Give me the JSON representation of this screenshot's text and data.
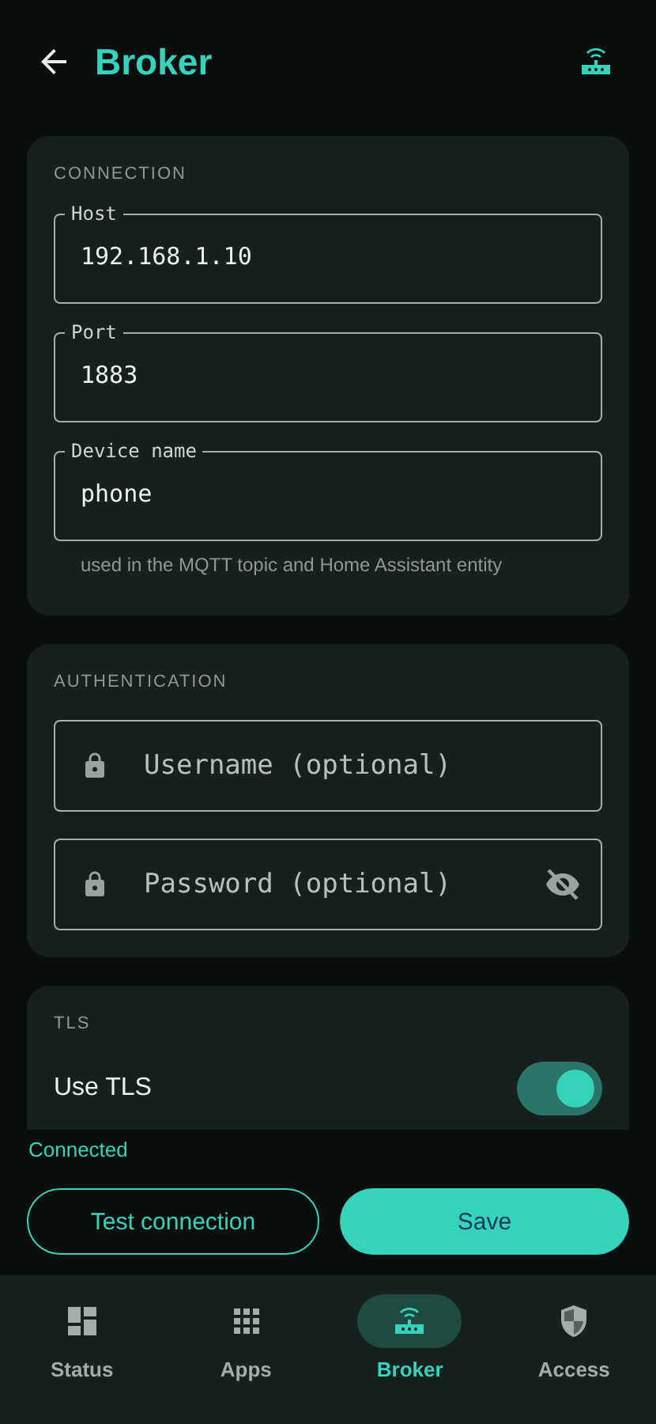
{
  "header": {
    "title": "Broker"
  },
  "sections": [
    {
      "title": "CONNECTION",
      "fields": [
        {
          "label": "Host",
          "value": "192.168.1.10"
        },
        {
          "label": "Port",
          "value": "1883"
        },
        {
          "label": "Device name",
          "value": "phone",
          "helper": "used in the MQTT topic and Home Assistant entity"
        }
      ]
    },
    {
      "title": "AUTHENTICATION",
      "fields": [
        {
          "placeholder": "Username (optional)",
          "secret": false
        },
        {
          "placeholder": "Password (optional)",
          "secret": true
        }
      ]
    },
    {
      "title": "TLS",
      "toggles": [
        {
          "label": "Use TLS",
          "on": true
        }
      ]
    }
  ],
  "status": "Connected",
  "buttons": [
    {
      "label": "Test connection",
      "kind": "outlined"
    },
    {
      "label": "Save",
      "kind": "filled"
    }
  ],
  "nav": [
    {
      "label": "Status",
      "kind": "dashboard",
      "selected": false
    },
    {
      "label": "Apps",
      "kind": "apps",
      "selected": false
    },
    {
      "label": "Broker",
      "kind": "router",
      "selected": true
    },
    {
      "label": "Access",
      "kind": "shield",
      "selected": false
    }
  ]
}
